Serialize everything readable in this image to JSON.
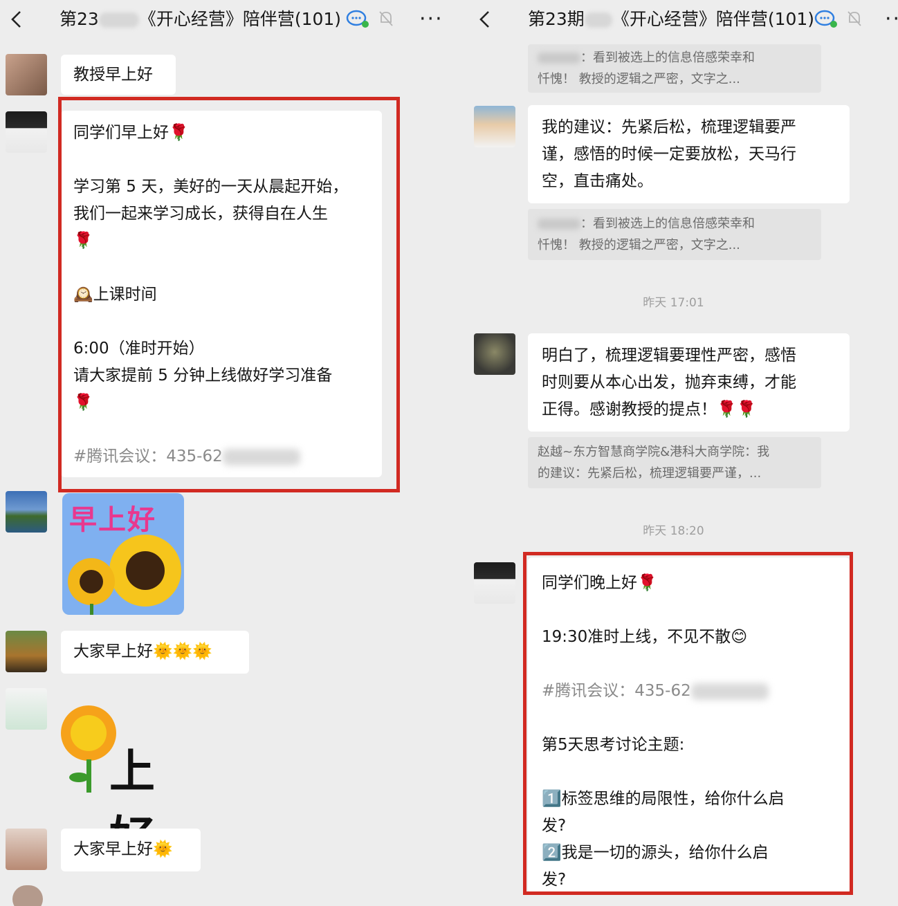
{
  "left": {
    "header": {
      "title_prefix": "第23",
      "title_suffix": "《开心经营》陪伴营(101)",
      "more": "···"
    },
    "messages": {
      "m1": "教授早上好",
      "m2": {
        "l1": "同学们早上好🌹",
        "l2": "学习第 5 天，美好的一天从晨起开始，",
        "l3": "我们一起来学习成长，获得自在人生",
        "l4": "🌹",
        "l5": "🕰️上课时间",
        "l6": "6:00（准时开始）",
        "l7": "请大家提前 5 分钟上线做好学习准备",
        "l8": "🌹",
        "l9": "#腾讯会议：435-62"
      },
      "sticker1_text": "早上好",
      "m3": "大家早上好🌞🌞🌞",
      "sticker2_text": "上好",
      "m4": "大家早上好🌞"
    }
  },
  "right": {
    "header": {
      "title_prefix": "第23期",
      "title_suffix": "《开心经营》陪伴营(101)",
      "more": "··"
    },
    "quote_top": {
      "l1": "：看到被选上的信息倍感荣幸和",
      "l2": "忏愧！        教授的逻辑之严密，文字之..."
    },
    "msg_advice": {
      "l1": "我的建议：先紧后松，梳理逻辑要严",
      "l2": "谨，感悟的时候一定要放松，天马行",
      "l3": "空，直击痛处。"
    },
    "quote_mid": {
      "l1": "：看到被选上的信息倍感荣幸和",
      "l2": "忏愧！        教授的逻辑之严密，文字之..."
    },
    "time1": "昨天 17:01",
    "msg_reply": {
      "l1": "明白了，梳理逻辑要理性严密，感悟",
      "l2": "时则要从本心出发，抛弃束缚，才能",
      "l3": "正得。感谢教授的提点！🌹🌹"
    },
    "quote_bottom": {
      "l1": "赵越~东方智慧商学院&港科大商学院：我",
      "l2": "的建议：先紧后松，梳理逻辑要严谨，..."
    },
    "time2": "昨天 18:20",
    "msg_evening": {
      "l1": "同学们晚上好🌹",
      "l2": "19:30准时上线，不见不散😊",
      "l3": "#腾讯会议：435-62",
      "l4": "第5天思考讨论主题:",
      "l5": "1️⃣标签思维的局限性，给你什么启",
      "l6": "发?",
      "l7": "2️⃣我是一切的源头，给你什么启",
      "l8": "发?"
    }
  },
  "colors": {
    "highlight": "#d12a22",
    "background": "#ededed",
    "bubble": "#ffffff",
    "quote": "#e3e3e3"
  },
  "icons": [
    "back-icon",
    "group-chat-icon",
    "mute-bell-icon",
    "more-icon"
  ]
}
